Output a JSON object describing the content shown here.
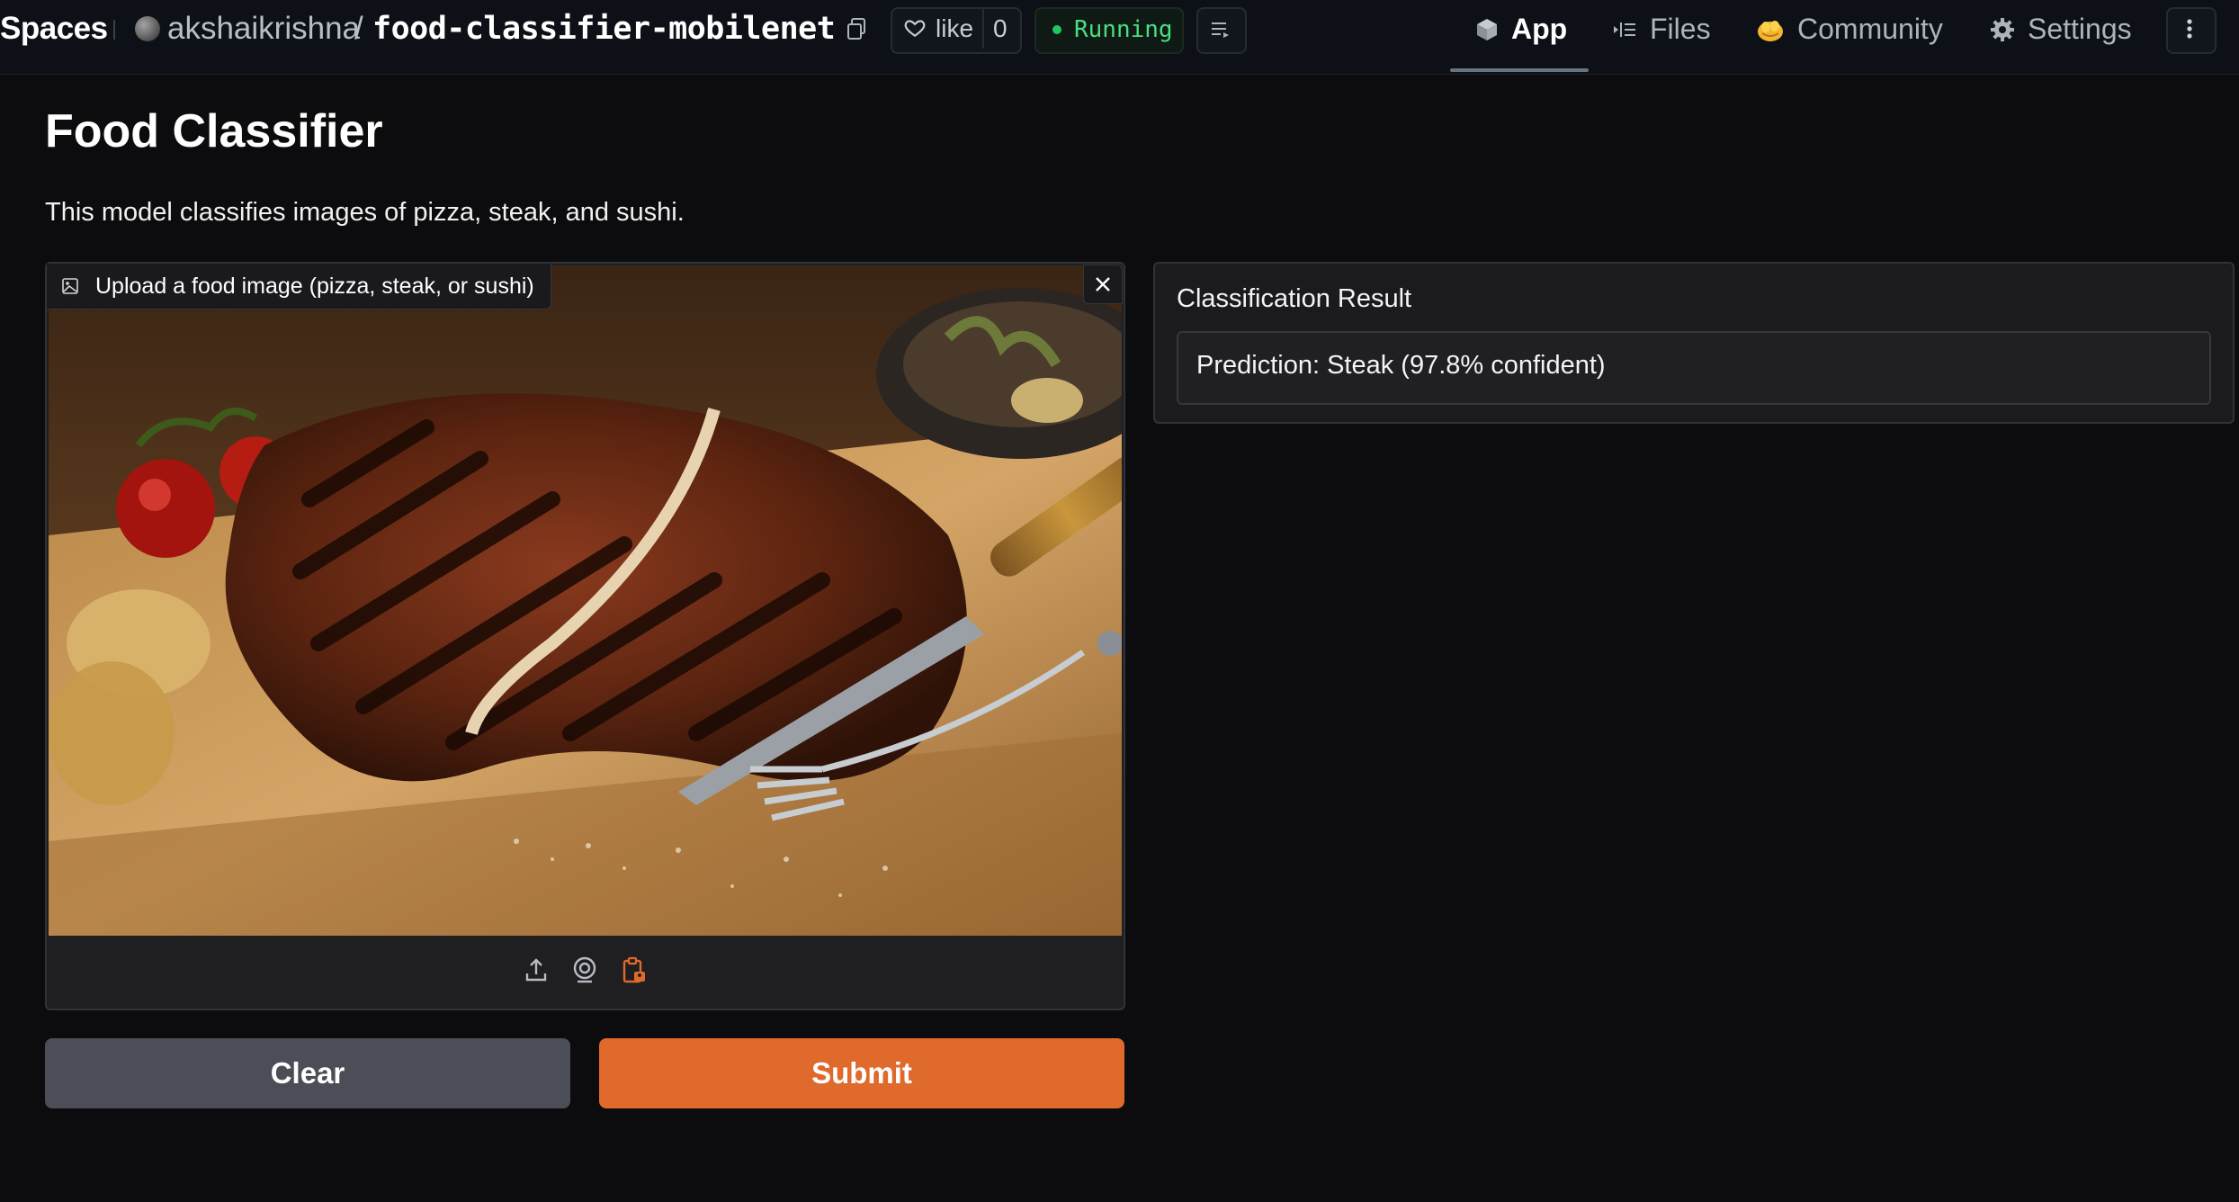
{
  "header": {
    "spaces_label": "Spaces",
    "owner": "akshaikrishna",
    "separator": "/",
    "repo": "food-classifier-mobilenet",
    "like_label": "like",
    "like_count": "0",
    "status": "Running",
    "status_color": "#22c55e",
    "nav": {
      "app": "App",
      "files": "Files",
      "community": "Community",
      "settings": "Settings"
    }
  },
  "main": {
    "title": "Food Classifier",
    "description": "This model classifies images of pizza, steak, and sushi.",
    "image_input": {
      "label": "Upload a food image (pizza, steak, or sushi)",
      "tools": [
        "upload-icon",
        "webcam-icon",
        "clipboard-icon"
      ]
    },
    "buttons": {
      "clear": "Clear",
      "submit": "Submit",
      "submit_color": "#e0692c"
    },
    "output": {
      "label": "Classification Result",
      "value": "Prediction: Steak (97.8% confident)"
    }
  }
}
